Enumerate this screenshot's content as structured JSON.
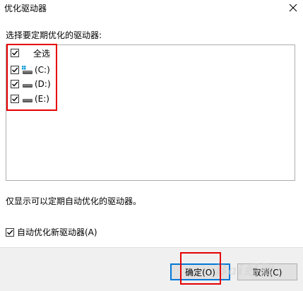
{
  "dialog": {
    "title": "优化驱动器"
  },
  "prompt": "选择要定期优化的驱动器:",
  "list": {
    "select_all": {
      "label": "全选",
      "checked": true
    },
    "drives": [
      {
        "label": "(C:)",
        "icon": "system-drive-icon",
        "checked": true
      },
      {
        "label": "(D:)",
        "icon": "drive-icon",
        "checked": true
      },
      {
        "label": "(E:)",
        "icon": "drive-icon",
        "checked": true
      }
    ]
  },
  "info": "仅显示可以定期自动优化的驱动器。",
  "auto_optimize": {
    "label": "自动优化新驱动器(A)",
    "checked": true
  },
  "buttons": {
    "ok": "确定(O)",
    "cancel": "取消(C)"
  },
  "watermark": "Bai经验",
  "colors": {
    "accent": "#0078d7",
    "highlight": "#e60000"
  }
}
